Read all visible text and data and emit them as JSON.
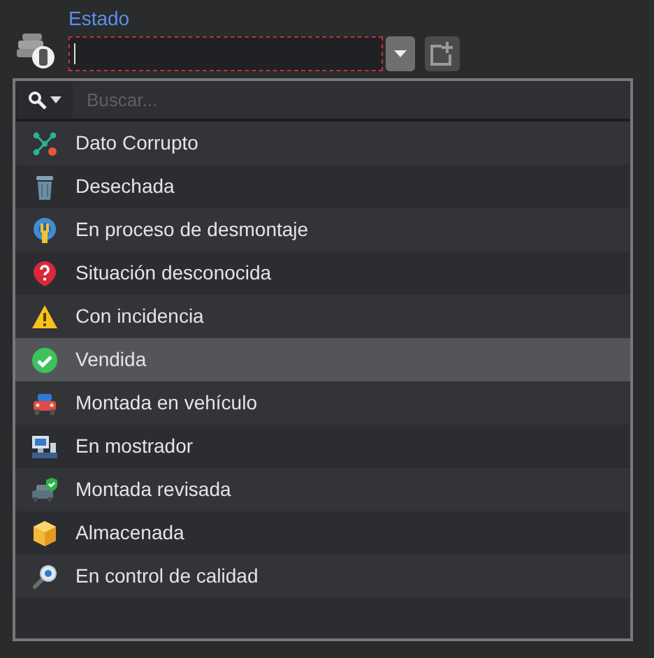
{
  "field": {
    "label": "Estado",
    "invalid": true
  },
  "search": {
    "placeholder": "Buscar..."
  },
  "options": [
    {
      "label": "Dato Corrupto",
      "selected": false
    },
    {
      "label": "Desechada",
      "selected": false
    },
    {
      "label": "En proceso de desmontaje",
      "selected": false
    },
    {
      "label": "Situación desconocida",
      "selected": false
    },
    {
      "label": "Con incidencia",
      "selected": false
    },
    {
      "label": "Vendida",
      "selected": true
    },
    {
      "label": "Montada en vehículo",
      "selected": false
    },
    {
      "label": "En mostrador",
      "selected": false
    },
    {
      "label": "Montada revisada",
      "selected": false
    },
    {
      "label": "Almacenada",
      "selected": false
    },
    {
      "label": "En control de calidad",
      "selected": false
    }
  ]
}
